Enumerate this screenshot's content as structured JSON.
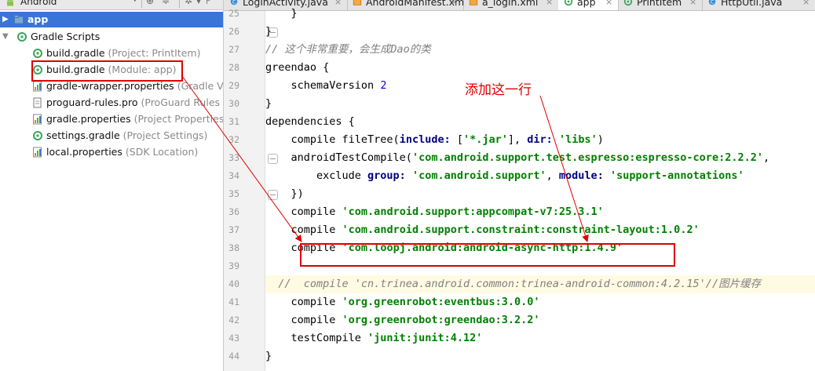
{
  "project_pane": {
    "view_mode": "Android",
    "colors": {
      "selection": "#3875d7",
      "gradle_icon": "#3aa55b"
    }
  },
  "tree": [
    {
      "label": "app",
      "sub": "",
      "icon": "folder-icon",
      "arrow": "▶",
      "selected": true
    },
    {
      "label": "Gradle Scripts",
      "sub": "",
      "icon": "gradle-icon",
      "arrow": "▼",
      "selected": false
    },
    {
      "label": "build.gradle",
      "sub": "(Project: PrintItem)",
      "icon": "gradle-icon",
      "arrow": "",
      "selected": false
    },
    {
      "label": "build.gradle",
      "sub": "(Module: app)",
      "icon": "gradle-icon",
      "arrow": "",
      "selected": false
    },
    {
      "label": "gradle-wrapper.properties",
      "sub": "(Gradle Version)",
      "icon": "properties-icon",
      "arrow": "",
      "selected": false
    },
    {
      "label": "proguard-rules.pro",
      "sub": "(ProGuard Rules for app)",
      "icon": "file-icon",
      "arrow": "",
      "selected": false
    },
    {
      "label": "gradle.properties",
      "sub": "(Project Properties)",
      "icon": "properties-icon",
      "arrow": "",
      "selected": false
    },
    {
      "label": "settings.gradle",
      "sub": "(Project Settings)",
      "icon": "gradle-icon",
      "arrow": "",
      "selected": false
    },
    {
      "label": "local.properties",
      "sub": "(SDK Location)",
      "icon": "properties-icon",
      "arrow": "",
      "selected": false
    }
  ],
  "tabs": [
    {
      "label": "LoginActivity.java",
      "icon": "java-class-icon",
      "active": false
    },
    {
      "label": "AndroidManifest.xml",
      "icon": "xml-icon",
      "active": false
    },
    {
      "label": "a_login.xml",
      "icon": "xml-icon",
      "active": false
    },
    {
      "label": "app",
      "icon": "gradle-icon",
      "active": true
    },
    {
      "label": "PrintItem",
      "icon": "gradle-icon",
      "active": false
    },
    {
      "label": "HttpUtil.java",
      "icon": "java-class-icon",
      "active": false
    }
  ],
  "code_lines": [
    {
      "n": "25",
      "tokens": [
        {
          "t": "    }"
        }
      ]
    },
    {
      "n": "26",
      "tokens": [
        {
          "t": "}"
        }
      ]
    },
    {
      "n": "27",
      "tokens": [
        {
          "t": "// 这个非常重要，会生成Dao的类",
          "c": "cmt"
        }
      ]
    },
    {
      "n": "28",
      "tokens": [
        {
          "t": "greendao {"
        }
      ]
    },
    {
      "n": "29",
      "tokens": [
        {
          "t": "    schemaVersion "
        },
        {
          "t": "2",
          "c": "num"
        }
      ]
    },
    {
      "n": "30",
      "tokens": [
        {
          "t": "}"
        }
      ]
    },
    {
      "n": "31",
      "tokens": [
        {
          "t": "dependencies {"
        }
      ]
    },
    {
      "n": "32",
      "tokens": [
        {
          "t": "    compile fileTree("
        },
        {
          "t": "include:",
          "c": "kw"
        },
        {
          "t": " ["
        },
        {
          "t": "'*.jar'",
          "c": "str"
        },
        {
          "t": "], "
        },
        {
          "t": "dir:",
          "c": "kw"
        },
        {
          "t": " "
        },
        {
          "t": "'libs'",
          "c": "str"
        },
        {
          "t": ")"
        }
      ]
    },
    {
      "n": "33",
      "tokens": [
        {
          "t": "    androidTestCompile("
        },
        {
          "t": "'com.android.support.test.espresso:espresso-core:2.2.2'",
          "c": "str"
        },
        {
          "t": ","
        }
      ]
    },
    {
      "n": "34",
      "tokens": [
        {
          "t": "        exclude "
        },
        {
          "t": "group:",
          "c": "kw"
        },
        {
          "t": " "
        },
        {
          "t": "'com.android.support'",
          "c": "str"
        },
        {
          "t": ", "
        },
        {
          "t": "module:",
          "c": "kw"
        },
        {
          "t": " "
        },
        {
          "t": "'support-annotations'",
          "c": "str"
        }
      ]
    },
    {
      "n": "35",
      "tokens": [
        {
          "t": "    })"
        }
      ]
    },
    {
      "n": "36",
      "tokens": [
        {
          "t": "    compile "
        },
        {
          "t": "'com.android.support:appcompat-v7:25.3.1'",
          "c": "str"
        }
      ]
    },
    {
      "n": "37",
      "tokens": [
        {
          "t": "    compile "
        },
        {
          "t": "'com.android.support.constraint:constraint-layout:1.0.2'",
          "c": "str"
        }
      ]
    },
    {
      "n": "38",
      "tokens": [
        {
          "t": "    compile "
        },
        {
          "t": "'com.loopj.android:android-async-http:1.4.9'",
          "c": "str"
        }
      ]
    },
    {
      "n": "39",
      "tokens": [
        {
          "t": ""
        }
      ]
    },
    {
      "n": "40",
      "tokens": [
        {
          "t": "  //  compile 'cn.trinea.android.common:trinea-android-common:4.2.15'//图片缓存",
          "c": "cmt"
        }
      ],
      "highlight": true
    },
    {
      "n": "41",
      "tokens": [
        {
          "t": "    compile "
        },
        {
          "t": "'org.greenrobot:eventbus:3.0.0'",
          "c": "str"
        }
      ]
    },
    {
      "n": "42",
      "tokens": [
        {
          "t": "    compile "
        },
        {
          "t": "'org.greenrobot:greendao:3.2.2'",
          "c": "str"
        }
      ]
    },
    {
      "n": "43",
      "tokens": [
        {
          "t": "    testCompile "
        },
        {
          "t": "'junit:junit:4.12'",
          "c": "str"
        }
      ]
    },
    {
      "n": "44",
      "tokens": [
        {
          "t": "}"
        }
      ]
    }
  ],
  "annotation": {
    "text": "添加这一行",
    "color": "#e00000"
  },
  "syntax_colors": {
    "keyword": "#000080",
    "string": "#008000",
    "comment": "#808080",
    "number": "#0000ff"
  }
}
